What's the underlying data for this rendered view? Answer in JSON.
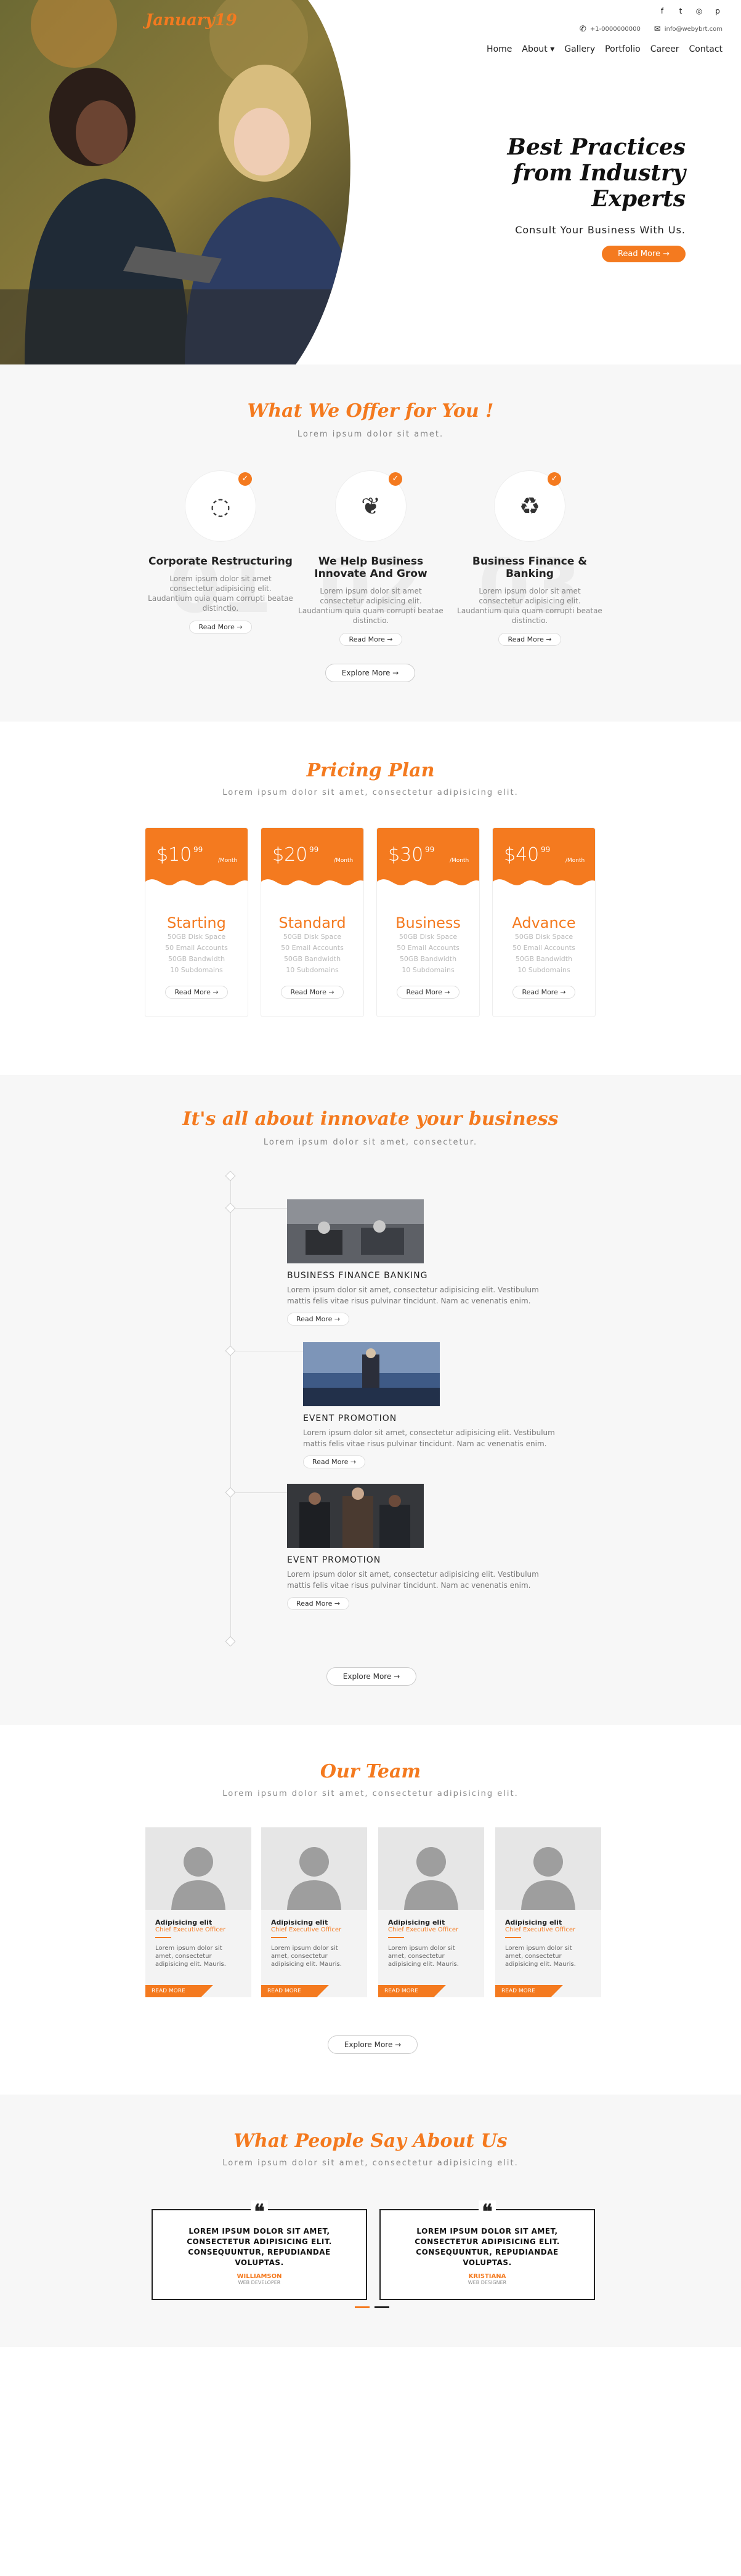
{
  "brand": {
    "logo": "January19",
    "accent": "#f47a1f"
  },
  "social": [
    {
      "icon": "facebook-icon",
      "glyph": "f"
    },
    {
      "icon": "twitter-icon",
      "glyph": "t"
    },
    {
      "icon": "instagram-icon",
      "glyph": "◎"
    },
    {
      "icon": "pinterest-icon",
      "glyph": "p"
    }
  ],
  "contact": {
    "phone": "+1-0000000000",
    "email": "info@webybrt.com"
  },
  "nav": [
    "Home",
    "About ▾",
    "Gallery",
    "Portfolio",
    "Career",
    "Contact"
  ],
  "hero": {
    "title": "Best Practices from Industry Experts",
    "subtitle": "Consult Your Business With Us.",
    "cta": "Read More →"
  },
  "offer": {
    "title": "What We Offer for You !",
    "subtitle": "Lorem ipsum dolor sit amet.",
    "cards": [
      {
        "num": "01",
        "title": "Corporate Restructuring",
        "desc": "Lorem ipsum dolor sit amet consectetur adipisicing elit. Laudantium quia quam corrupti beatae distinctio.",
        "btn": "Read More →",
        "icon": "globe-icon"
      },
      {
        "num": "02",
        "title": "We Help Business Innovate And Grow",
        "desc": "Lorem ipsum dolor sit amet consectetur adipisicing elit. Laudantium quia quam corrupti beatae distinctio.",
        "btn": "Read More →",
        "icon": "leaf-icon"
      },
      {
        "num": "03",
        "title": "Business Finance & Banking",
        "desc": "Lorem ipsum dolor sit amet consectetur adipisicing elit. Laudantium quia quam corrupti beatae distinctio.",
        "btn": "Read More →",
        "icon": "recycle-icon"
      }
    ],
    "explore": "Explore More →"
  },
  "pricing": {
    "title": "Pricing Plan",
    "subtitle": "Lorem ipsum dolor sit amet, consectetur adipisicing elit.",
    "plans": [
      {
        "price": "$10",
        "cents": "99",
        "per": "/Month",
        "name": "Starting",
        "features": [
          "50GB Disk Space",
          "50 Email Accounts",
          "50GB Bandwidth",
          "10 Subdomains"
        ],
        "btn": "Read More →"
      },
      {
        "price": "$20",
        "cents": "99",
        "per": "/Month",
        "name": "Standard",
        "features": [
          "50GB Disk Space",
          "50 Email Accounts",
          "50GB Bandwidth",
          "10 Subdomains"
        ],
        "btn": "Read More →"
      },
      {
        "price": "$30",
        "cents": "99",
        "per": "/Month",
        "name": "Business",
        "features": [
          "50GB Disk Space",
          "50 Email Accounts",
          "50GB Bandwidth",
          "10 Subdomains"
        ],
        "btn": "Read More →"
      },
      {
        "price": "$40",
        "cents": "99",
        "per": "/Month",
        "name": "Advance",
        "features": [
          "50GB Disk Space",
          "50 Email Accounts",
          "50GB Bandwidth",
          "10 Subdomains"
        ],
        "btn": "Read More →"
      }
    ]
  },
  "innovate": {
    "title": "It's all about innovate your business",
    "subtitle": "Lorem ipsum dolor sit amet, consectetur.",
    "items": [
      {
        "title": "BUSINESS FINANCE BANKING",
        "desc": "Lorem ipsum dolor sit amet, consectetur adipisicing elit. Vestibulum mattis felis vitae risus pulvinar tincidunt. Nam ac venenatis enim.",
        "btn": "Read More →"
      },
      {
        "title": "EVENT PROMOTION",
        "desc": "Lorem ipsum dolor sit amet, consectetur adipisicing elit. Vestibulum mattis felis vitae risus pulvinar tincidunt. Nam ac venenatis enim.",
        "btn": "Read More →"
      },
      {
        "title": "EVENT PROMOTION",
        "desc": "Lorem ipsum dolor sit amet, consectetur adipisicing elit. Vestibulum mattis felis vitae risus pulvinar tincidunt. Nam ac venenatis enim.",
        "btn": "Read More →"
      }
    ],
    "explore": "Explore More →"
  },
  "team": {
    "title": "Our Team",
    "subtitle": "Lorem ipsum dolor sit amet, consectetur adipisicing elit.",
    "members": [
      {
        "name": "Adipisicing elit",
        "role": "Chief Executive Officer",
        "desc": "Lorem ipsum dolor sit amet, consectetur adipisicing elit. Mauris.",
        "tag": "READ MORE"
      },
      {
        "name": "Adipisicing elit",
        "role": "Chief Executive Officer",
        "desc": "Lorem ipsum dolor sit amet, consectetur adipisicing elit. Mauris.",
        "tag": "READ MORE"
      },
      {
        "name": "Adipisicing elit",
        "role": "Chief Executive Officer",
        "desc": "Lorem ipsum dolor sit amet, consectetur adipisicing elit. Mauris.",
        "tag": "READ MORE"
      },
      {
        "name": "Adipisicing elit",
        "role": "Chief Executive Officer",
        "desc": "Lorem ipsum dolor sit amet, consectetur adipisicing elit. Mauris.",
        "tag": "READ MORE"
      }
    ],
    "explore": "Explore More →"
  },
  "testimonials": {
    "title": "What People Say About Us",
    "subtitle": "Lorem ipsum dolor sit amet, consectetur adipisicing elit.",
    "items": [
      {
        "text": "LOREM IPSUM DOLOR SIT AMET, CONSECTETUR ADIPISICING ELIT. CONSEQUUNTUR, REPUDIANDAE VOLUPTAS.",
        "name": "WILLIAMSON",
        "loc": "WEB DEVELOPER"
      },
      {
        "text": "LOREM IPSUM DOLOR SIT AMET, CONSECTETUR ADIPISICING ELIT. CONSEQUUNTUR, REPUDIANDAE VOLUPTAS.",
        "name": "KRISTIANA",
        "loc": "WEB DESIGNER"
      }
    ]
  }
}
